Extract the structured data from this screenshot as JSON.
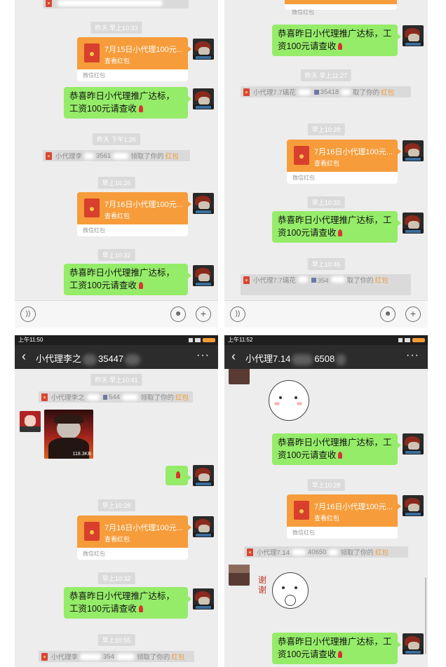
{
  "p1": {
    "ts1": "昨天 早上10:33",
    "rp1_title": "7月15日小代理100元...",
    "rp_sub": "查看红包",
    "rp_foot": "微信红包",
    "msg1": "恭喜昨日小代理推广达标，工资100元请查收",
    "ts2": "昨天 下午1:26",
    "sys1_a": "小代理李",
    "sys1_b": "3561",
    "sys1_c": "领取了你的",
    "sys1_d": "红包",
    "ts3": "早上10:26",
    "rp2_title": "7月16日小代理100元...",
    "ts4": "早上10:32",
    "msg2": "恭喜昨日小代理推广达标，工资100元请查收"
  },
  "p2": {
    "ts1": "昨天 早上11:27",
    "sys1_a": "小代理7.7璃花",
    "sys1_b": "35418",
    "sys1_c": "取了你的",
    "sys1_d": "红包",
    "ts2": "早上10:28",
    "rp_title": "7月16日小代理100元...",
    "rp_sub": "查看红包",
    "rp_foot": "微信红包",
    "ts3": "早上10:32",
    "msg": "恭喜昨日小代理推广达标，工资100元请查收",
    "ts4": "早上10:46",
    "sys2_a": "小代理7.7璃花",
    "sys2_b": "354",
    "sys2_c": "取了你的",
    "sys2_d": "红包"
  },
  "p3": {
    "time": "上午11:50",
    "title_a": "小代理李之",
    "title_b": "35447",
    "ts1": "昨天 早上10:41",
    "sys1_a": "小代理李之",
    "sys1_b": "544",
    "sys1_c": "领取了你的",
    "sys1_d": "红包",
    "img_size": "118.3KB",
    "ts2": "早上10:28",
    "rp_title": "7月16日小代理100元...",
    "rp_sub": "查看红包",
    "rp_foot": "微信红包",
    "ts3": "早上10:32",
    "msg": "恭喜昨日小代理推广达标，工资100元请查收",
    "ts4": "早上10:55",
    "sys2_a": "小代理李",
    "sys2_b": "354",
    "sys2_c": "领取了你的",
    "sys2_d": "红包"
  },
  "p4": {
    "time": "上午11:52",
    "title_a": "小代理7.14",
    "title_b": "6508",
    "msg1": "恭喜昨日小代理推广达标，工资100元请查收",
    "ts1": "早上10:28",
    "rp_title": "7月16日小代理100元...",
    "rp_sub": "查看红包",
    "rp_foot": "微信红包",
    "sys1_a": "小代理7.14",
    "sys1_b": "40650",
    "sys1_c": "领取了你的",
    "sys1_d": "红包",
    "sticker_text": "谢谢",
    "msg2": "恭喜昨日小代理推广达标，工资100元请查收"
  },
  "icons": {
    "more": "···",
    "back": "‹",
    "plus": "+"
  }
}
